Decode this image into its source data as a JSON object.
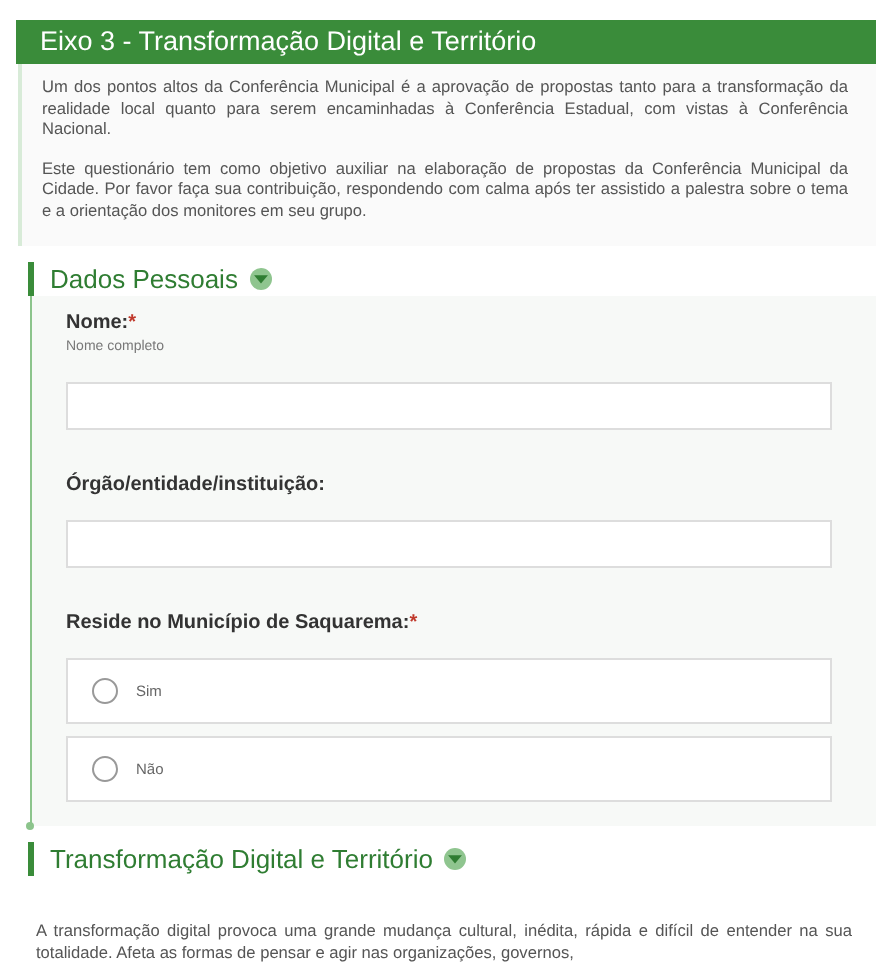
{
  "header": {
    "title": "Eixo 3 - Transformação Digital e Território"
  },
  "intro": [
    "Um dos pontos altos da Conferência Municipal é a aprovação de propostas tanto para a transformação da realidade local quanto para serem encaminhadas à Conferência Estadual, com vistas à Conferência Nacional.",
    "Este questionário tem como objetivo auxiliar na elaboração de propostas da Conferência Municipal da Cidade. Por favor faça sua contribuição, respondendo com calma após ter assistido a palestra sobre o tema e a orientação dos monitores em seu grupo."
  ],
  "sections": [
    {
      "title": "Dados Pessoais",
      "expanded": true,
      "questions": [
        {
          "kind": "text",
          "label": "Nome:",
          "required_mark": "*",
          "hint": "Nome completo"
        },
        {
          "kind": "text",
          "label": "Órgão/entidade/instituição:"
        },
        {
          "kind": "radio",
          "label": "Reside no Município de Saquarema:",
          "required_mark": "*",
          "options": [
            {
              "label": "Sim",
              "selected": false
            },
            {
              "label": "Não",
              "selected": false
            }
          ]
        }
      ]
    },
    {
      "title": "Transformação Digital e Território",
      "expanded": true,
      "text": "A transformação digital provoca uma grande mudança cultural, inédita, rápida e difícil de entender na sua totalidade. Afeta as formas de pensar e agir nas organizações, governos,"
    }
  ]
}
